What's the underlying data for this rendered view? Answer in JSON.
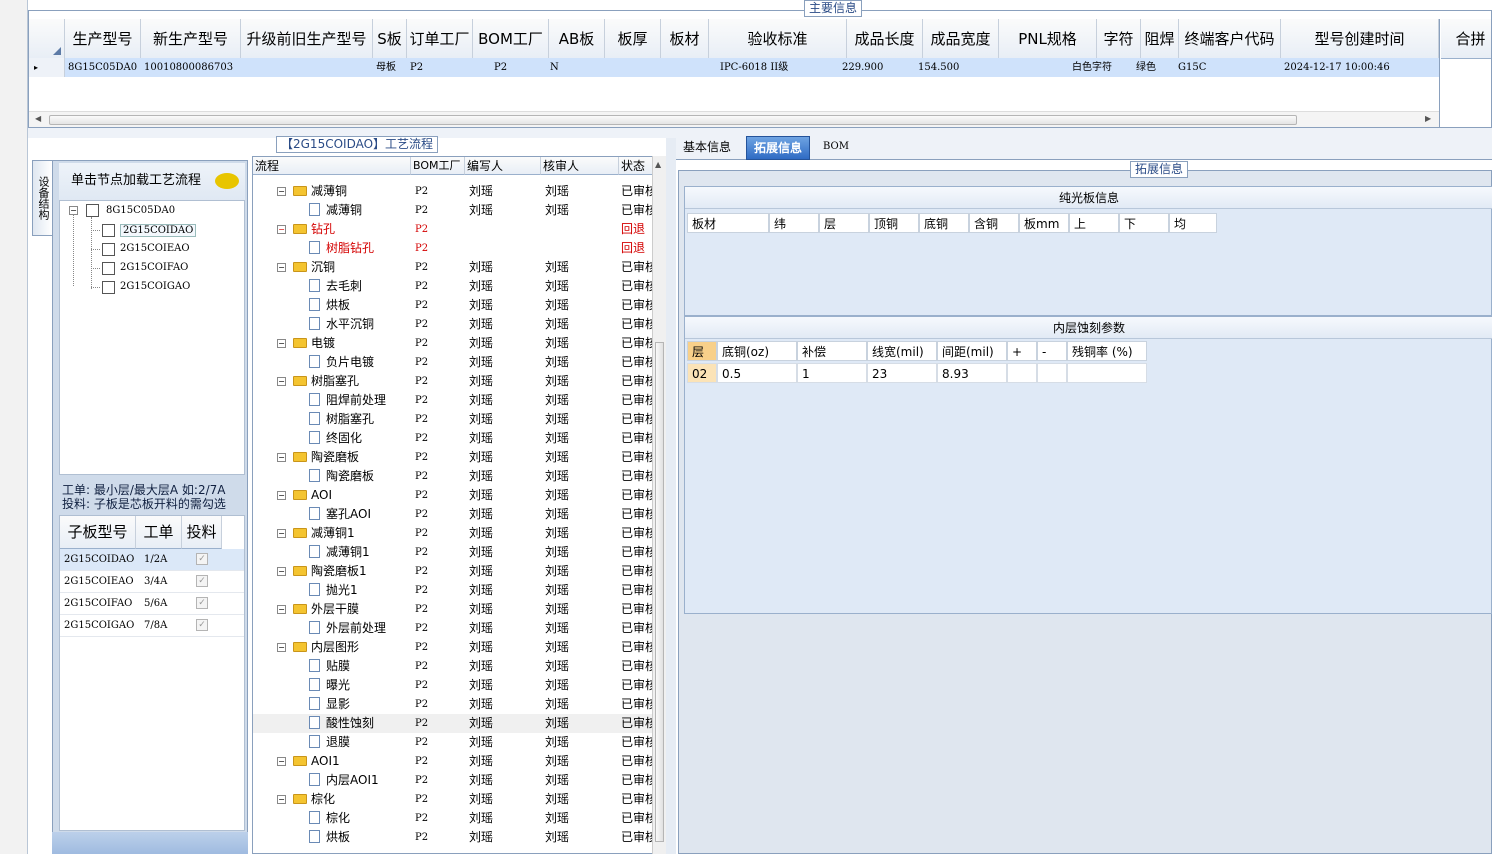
{
  "main_legend": "主要信息",
  "grid": {
    "headers": [
      "生产型号",
      "新生产型号",
      "升级前旧生产型号",
      "S板",
      "订单工厂",
      "BOM工厂",
      "AB板",
      "板厚",
      "板材",
      "验收标准",
      "成品长度",
      "成品宽度",
      "PNL规格",
      "字符",
      "阻焊",
      "终端客户代码",
      "型号创建时间",
      "合拼"
    ],
    "row": [
      "8G15C05DA0",
      "10010800086703",
      "",
      "母板",
      "P2",
      "P2",
      "N",
      "",
      "",
      "IPC-6018 II级",
      "229.900",
      "154.500",
      "",
      "白色字符",
      "绿色",
      "G15C",
      "2024-12-17 10:00:46",
      ""
    ],
    "row_marker": "▸"
  },
  "process_legend": "【2G15COIDAO】工艺流程",
  "left": {
    "vtab": "设备结构",
    "hint": "单击节点加载工艺流程",
    "root": "8G15C05DA0",
    "children": [
      "2G15COIDAO",
      "2G15COIEAO",
      "2G15COIFAO",
      "2G15COIGAO"
    ],
    "note1": "工单: 最小层/最大层A 如:2/7A",
    "note2": "投料: 子板是芯板开料的需勾选",
    "sub_headers": [
      "子板型号",
      "工单",
      "投料"
    ],
    "sub_rows": [
      {
        "model": "2G15COIDAO",
        "order": "1/2A"
      },
      {
        "model": "2G15COIEAO",
        "order": "3/4A"
      },
      {
        "model": "2G15COIFAO",
        "order": "5/6A"
      },
      {
        "model": "2G15COIGAO",
        "order": "7/8A"
      }
    ]
  },
  "process": {
    "headers": [
      "流程",
      "BOM工厂",
      "编写人",
      "核审人",
      "状态"
    ],
    "rows": [
      {
        "lvl": 0,
        "name": "减薄铜",
        "factory": "P2",
        "writer": "刘瑶",
        "reviewer": "刘瑶",
        "status": "已审核",
        "red": false
      },
      {
        "lvl": 1,
        "name": "减薄铜",
        "factory": "P2",
        "writer": "刘瑶",
        "reviewer": "刘瑶",
        "status": "已审核",
        "red": false
      },
      {
        "lvl": 0,
        "name": "钻孔",
        "factory": "P2",
        "writer": "",
        "reviewer": "",
        "status": "回退",
        "red": true
      },
      {
        "lvl": 1,
        "name": "树脂钻孔",
        "factory": "P2",
        "writer": "",
        "reviewer": "",
        "status": "回退",
        "red": true
      },
      {
        "lvl": 0,
        "name": "沉铜",
        "factory": "P2",
        "writer": "刘瑶",
        "reviewer": "刘瑶",
        "status": "已审核",
        "red": false
      },
      {
        "lvl": 1,
        "name": "去毛刺",
        "factory": "P2",
        "writer": "刘瑶",
        "reviewer": "刘瑶",
        "status": "已审核",
        "red": false
      },
      {
        "lvl": 1,
        "name": "烘板",
        "factory": "P2",
        "writer": "刘瑶",
        "reviewer": "刘瑶",
        "status": "已审核",
        "red": false
      },
      {
        "lvl": 1,
        "name": "水平沉铜",
        "factory": "P2",
        "writer": "刘瑶",
        "reviewer": "刘瑶",
        "status": "已审核",
        "red": false
      },
      {
        "lvl": 0,
        "name": "电镀",
        "factory": "P2",
        "writer": "刘瑶",
        "reviewer": "刘瑶",
        "status": "已审核",
        "red": false
      },
      {
        "lvl": 1,
        "name": "负片电镀",
        "factory": "P2",
        "writer": "刘瑶",
        "reviewer": "刘瑶",
        "status": "已审核",
        "red": false
      },
      {
        "lvl": 0,
        "name": "树脂塞孔",
        "factory": "P2",
        "writer": "刘瑶",
        "reviewer": "刘瑶",
        "status": "已审核",
        "red": false
      },
      {
        "lvl": 1,
        "name": "阻焊前处理",
        "factory": "P2",
        "writer": "刘瑶",
        "reviewer": "刘瑶",
        "status": "已审核",
        "red": false
      },
      {
        "lvl": 1,
        "name": "树脂塞孔",
        "factory": "P2",
        "writer": "刘瑶",
        "reviewer": "刘瑶",
        "status": "已审核",
        "red": false
      },
      {
        "lvl": 1,
        "name": "终固化",
        "factory": "P2",
        "writer": "刘瑶",
        "reviewer": "刘瑶",
        "status": "已审核",
        "red": false
      },
      {
        "lvl": 0,
        "name": "陶瓷磨板",
        "factory": "P2",
        "writer": "刘瑶",
        "reviewer": "刘瑶",
        "status": "已审核",
        "red": false
      },
      {
        "lvl": 1,
        "name": "陶瓷磨板",
        "factory": "P2",
        "writer": "刘瑶",
        "reviewer": "刘瑶",
        "status": "已审核",
        "red": false
      },
      {
        "lvl": 0,
        "name": "AOI",
        "factory": "P2",
        "writer": "刘瑶",
        "reviewer": "刘瑶",
        "status": "已审核",
        "red": false
      },
      {
        "lvl": 1,
        "name": "塞孔AOI",
        "factory": "P2",
        "writer": "刘瑶",
        "reviewer": "刘瑶",
        "status": "已审核",
        "red": false
      },
      {
        "lvl": 0,
        "name": "减薄铜1",
        "factory": "P2",
        "writer": "刘瑶",
        "reviewer": "刘瑶",
        "status": "已审核",
        "red": false
      },
      {
        "lvl": 1,
        "name": "减薄铜1",
        "factory": "P2",
        "writer": "刘瑶",
        "reviewer": "刘瑶",
        "status": "已审核",
        "red": false
      },
      {
        "lvl": 0,
        "name": "陶瓷磨板1",
        "factory": "P2",
        "writer": "刘瑶",
        "reviewer": "刘瑶",
        "status": "已审核",
        "red": false
      },
      {
        "lvl": 1,
        "name": "抛光1",
        "factory": "P2",
        "writer": "刘瑶",
        "reviewer": "刘瑶",
        "status": "已审核",
        "red": false
      },
      {
        "lvl": 0,
        "name": "外层干膜",
        "factory": "P2",
        "writer": "刘瑶",
        "reviewer": "刘瑶",
        "status": "已审核",
        "red": false
      },
      {
        "lvl": 1,
        "name": "外层前处理",
        "factory": "P2",
        "writer": "刘瑶",
        "reviewer": "刘瑶",
        "status": "已审核",
        "red": false
      },
      {
        "lvl": 0,
        "name": "内层图形",
        "factory": "P2",
        "writer": "刘瑶",
        "reviewer": "刘瑶",
        "status": "已审核",
        "red": false
      },
      {
        "lvl": 1,
        "name": "贴膜",
        "factory": "P2",
        "writer": "刘瑶",
        "reviewer": "刘瑶",
        "status": "已审核",
        "red": false
      },
      {
        "lvl": 1,
        "name": "曝光",
        "factory": "P2",
        "writer": "刘瑶",
        "reviewer": "刘瑶",
        "status": "已审核",
        "red": false
      },
      {
        "lvl": 1,
        "name": "显影",
        "factory": "P2",
        "writer": "刘瑶",
        "reviewer": "刘瑶",
        "status": "已审核",
        "red": false
      },
      {
        "lvl": 1,
        "name": "酸性蚀刻",
        "factory": "P2",
        "writer": "刘瑶",
        "reviewer": "刘瑶",
        "status": "已审核",
        "red": false
      },
      {
        "lvl": 1,
        "name": "退膜",
        "factory": "P2",
        "writer": "刘瑶",
        "reviewer": "刘瑶",
        "status": "已审核",
        "red": false
      },
      {
        "lvl": 0,
        "name": "AOI1",
        "factory": "P2",
        "writer": "刘瑶",
        "reviewer": "刘瑶",
        "status": "已审核",
        "red": false
      },
      {
        "lvl": 1,
        "name": "内层AOI1",
        "factory": "P2",
        "writer": "刘瑶",
        "reviewer": "刘瑶",
        "status": "已审核",
        "red": false
      },
      {
        "lvl": 0,
        "name": "棕化",
        "factory": "P2",
        "writer": "刘瑶",
        "reviewer": "刘瑶",
        "status": "已审核",
        "red": false
      },
      {
        "lvl": 1,
        "name": "棕化",
        "factory": "P2",
        "writer": "刘瑶",
        "reviewer": "刘瑶",
        "status": "已审核",
        "red": false
      },
      {
        "lvl": 1,
        "name": "烘板",
        "factory": "P2",
        "writer": "刘瑶",
        "reviewer": "刘瑶",
        "status": "已审核",
        "red": false
      }
    ]
  },
  "right": {
    "tabs": [
      "基本信息",
      "拓展信息",
      "BOM"
    ],
    "ext_legend": "拓展信息",
    "pure_title": "纯光板信息",
    "pure_headers": [
      "板材",
      "纬",
      "层",
      "顶铜",
      "底铜",
      "含铜",
      "板mm",
      "上",
      "下",
      "均"
    ],
    "etch_title": "内层蚀刻参数",
    "etch_headers": [
      "层",
      "底铜(oz)",
      "补偿",
      "线宽(mil)",
      "间距(mil)",
      "+",
      "-",
      "残铜率 (%)"
    ],
    "etch_row": [
      "02",
      "0.5",
      "1",
      "23",
      "8.93",
      "",
      "",
      ""
    ]
  },
  "colors": {
    "accent": "#2f6bc4",
    "selected_row": "#cfe2fb",
    "border": "#8aa0bd",
    "red": "#d40000"
  }
}
